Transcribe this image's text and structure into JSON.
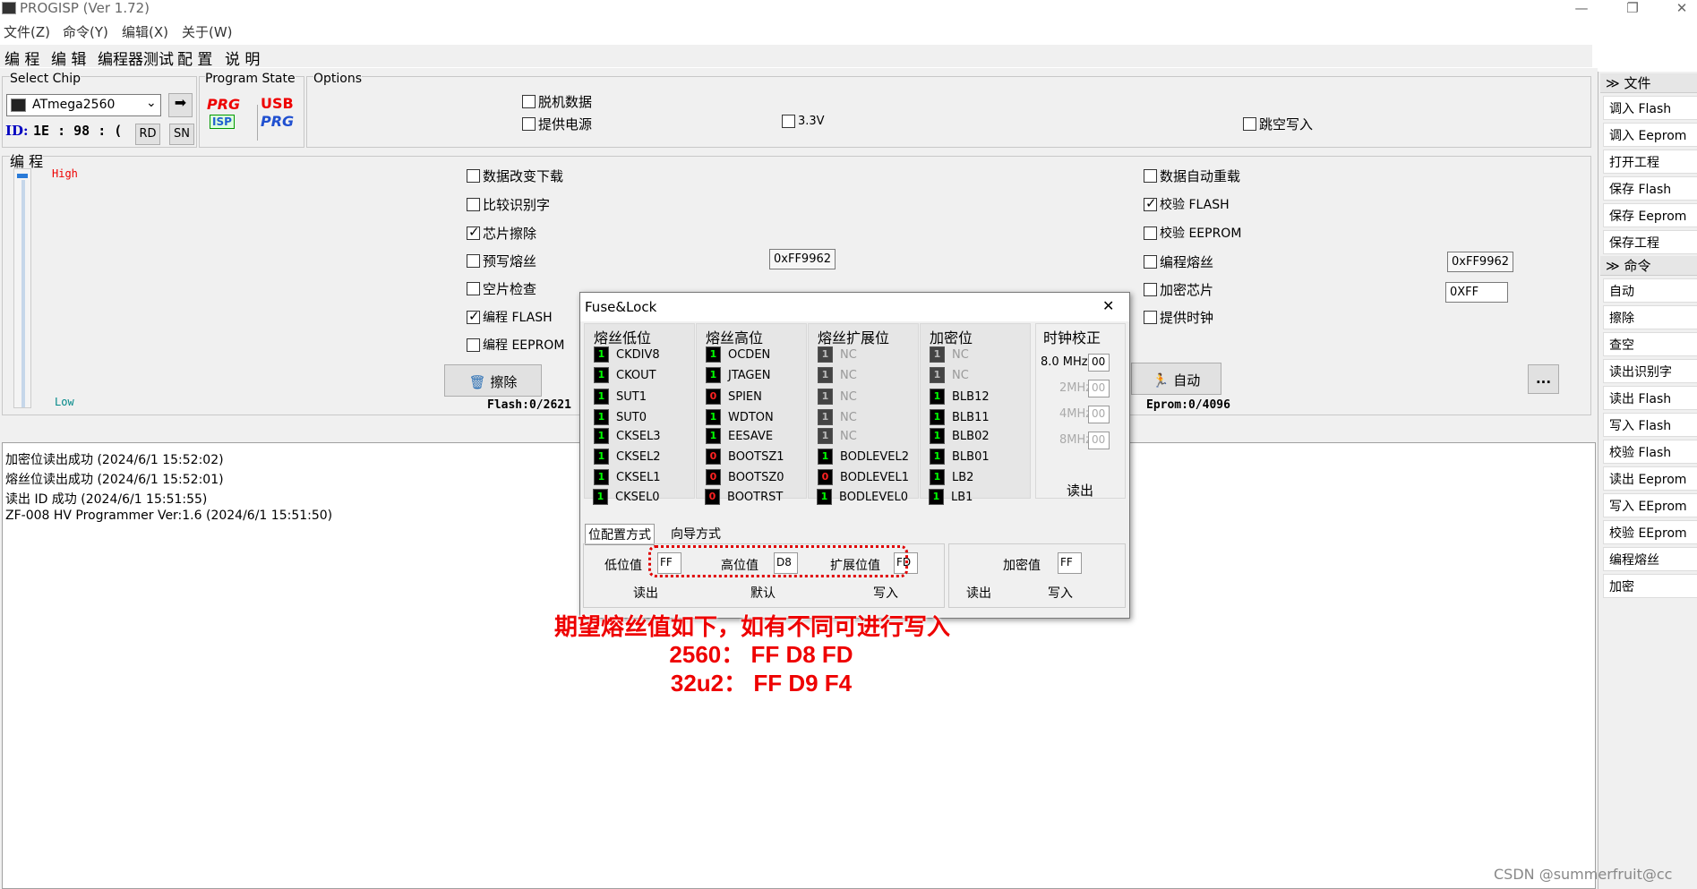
{
  "window": {
    "title": "PROGISP (Ver 1.72)",
    "minimize": "—",
    "restore": "❐",
    "close": "✕"
  },
  "menu": [
    "文件(Z)",
    "命令(Y)",
    "编辑(X)",
    "关于(W)"
  ],
  "tabs": [
    "编 程",
    "编 辑",
    "编程器测试",
    "配 置",
    "说 明"
  ],
  "select_chip": {
    "label": "Select Chip",
    "chip": "ATmega2560",
    "id_label": "ID:",
    "id_value": "1E  :  98  :  (",
    "rd": "RD",
    "sn": "SN",
    "go_icon": "arrow-right-icon"
  },
  "program_state": {
    "label": "Program State",
    "prg": "PRG",
    "isp": "ISP",
    "usb": "USB",
    "usb_prg": "PRG"
  },
  "options": {
    "label": "Options",
    "offline_data": "脱机数据",
    "supply_power": "提供电源",
    "v33": "3.3V",
    "skip_empty": "跳空写入"
  },
  "program": {
    "label": "编 程",
    "high": "High",
    "low": "Low",
    "left_checks": [
      {
        "label": "数据改变下载",
        "checked": false
      },
      {
        "label": "比较识别字",
        "checked": false
      },
      {
        "label": "芯片擦除",
        "checked": true
      },
      {
        "label": "预写熔丝",
        "checked": false
      },
      {
        "label": "空片检查",
        "checked": false
      },
      {
        "label": "编程 FLASH",
        "checked": true
      },
      {
        "label": "编程 EEPROM",
        "checked": false
      }
    ],
    "right_checks": [
      {
        "label": "数据自动重载",
        "checked": false
      },
      {
        "label": "校验 FLASH",
        "checked": true
      },
      {
        "label": "校验 EEPROM",
        "checked": false
      },
      {
        "label": "编程熔丝",
        "checked": false
      },
      {
        "label": "加密芯片",
        "checked": false
      },
      {
        "label": "提供时钟",
        "checked": false
      }
    ],
    "prewrite_fuse_value": "0xFF9962",
    "fuse_value": "0xFF9962",
    "lock_value": "0XFF",
    "erase_button": "擦除",
    "auto_button": "自动",
    "more_button": "...",
    "flash_info": "Flash:0/2621",
    "eeprom_info": "Eprom:0/4096"
  },
  "log": [
    "加密位读出成功 (2024/6/1 15:52:02)",
    "熔丝位读出成功 (2024/6/1 15:52:01)",
    "读出 ID 成功 (2024/6/1 15:51:55)",
    "ZF-008 HV Programmer Ver:1.6 (2024/6/1 15:51:50)"
  ],
  "right_panel": {
    "group_file": "文件",
    "file_items": [
      "调入 Flash",
      "调入 Eeprom",
      "打开工程",
      "保存 Flash",
      "保存 Eeprom",
      "保存工程"
    ],
    "group_cmd": "命令",
    "cmd_items": [
      "自动",
      "擦除",
      "查空",
      "读出识别字",
      "读出 Flash",
      "写入 Flash",
      "校验 Flash",
      "读出 Eeprom",
      "写入 EEprom",
      "校验 EEprom",
      "编程熔丝",
      "加密"
    ]
  },
  "fuse_dialog": {
    "title": "Fuse&Lock",
    "close": "✕",
    "columns": [
      {
        "header": "熔丝低位",
        "bits": [
          {
            "name": "CKDIV8",
            "value": "1"
          },
          {
            "name": "CKOUT",
            "value": "1"
          },
          {
            "name": "SUT1",
            "value": "1"
          },
          {
            "name": "SUT0",
            "value": "1"
          },
          {
            "name": "CKSEL3",
            "value": "1"
          },
          {
            "name": "CKSEL2",
            "value": "1"
          },
          {
            "name": "CKSEL1",
            "value": "1"
          },
          {
            "name": "CKSEL0",
            "value": "1"
          }
        ]
      },
      {
        "header": "熔丝高位",
        "bits": [
          {
            "name": "OCDEN",
            "value": "1"
          },
          {
            "name": "JTAGEN",
            "value": "1"
          },
          {
            "name": "SPIEN",
            "value": "0"
          },
          {
            "name": "WDTON",
            "value": "1"
          },
          {
            "name": "EESAVE",
            "value": "1"
          },
          {
            "name": "BOOTSZ1",
            "value": "0"
          },
          {
            "name": "BOOTSZ0",
            "value": "0"
          },
          {
            "name": "BOOTRST",
            "value": "0"
          }
        ]
      },
      {
        "header": "熔丝扩展位",
        "bits": [
          {
            "name": "NC",
            "value": "1",
            "disabled": true
          },
          {
            "name": "NC",
            "value": "1",
            "disabled": true
          },
          {
            "name": "NC",
            "value": "1",
            "disabled": true
          },
          {
            "name": "NC",
            "value": "1",
            "disabled": true
          },
          {
            "name": "NC",
            "value": "1",
            "disabled": true
          },
          {
            "name": "BODLEVEL2",
            "value": "1"
          },
          {
            "name": "BODLEVEL1",
            "value": "0"
          },
          {
            "name": "BODLEVEL0",
            "value": "1"
          }
        ]
      },
      {
        "header": "加密位",
        "bits": [
          {
            "name": "NC",
            "value": "1",
            "disabled": true
          },
          {
            "name": "NC",
            "value": "1",
            "disabled": true
          },
          {
            "name": "BLB12",
            "value": "1"
          },
          {
            "name": "BLB11",
            "value": "1"
          },
          {
            "name": "BLB02",
            "value": "1"
          },
          {
            "name": "BLB01",
            "value": "1"
          },
          {
            "name": "LB2",
            "value": "1"
          },
          {
            "name": "LB1",
            "value": "1"
          }
        ]
      }
    ],
    "clock": {
      "header": "时钟校正",
      "rows": [
        {
          "label": "8.0 MHz",
          "value": "00",
          "enabled": true
        },
        {
          "label": "2MHz",
          "value": "00",
          "enabled": false
        },
        {
          "label": "4MHz",
          "value": "00",
          "enabled": false
        },
        {
          "label": "8MHz",
          "value": "00",
          "enabled": false
        }
      ],
      "read": "读出"
    },
    "tabs": [
      "位配置方式",
      "向导方式"
    ],
    "low_label": "低位值",
    "low_value": "FF",
    "high_label": "高位值",
    "high_value": "D8",
    "ext_label": "扩展位值",
    "ext_value": "FD",
    "lock_label": "加密值",
    "lock_value": "FF",
    "read": "读出",
    "default": "默认",
    "write": "写入",
    "lock_read": "读出",
    "lock_write": "写入"
  },
  "annotation": {
    "line1": "期望熔丝值如下，如有不同可进行写入",
    "line2": "2560：  FF D8 FD",
    "line3": "32u2：  FF D9 F4",
    "highlight_color": "#e00000"
  },
  "watermark": "CSDN @summerfruit@cc"
}
